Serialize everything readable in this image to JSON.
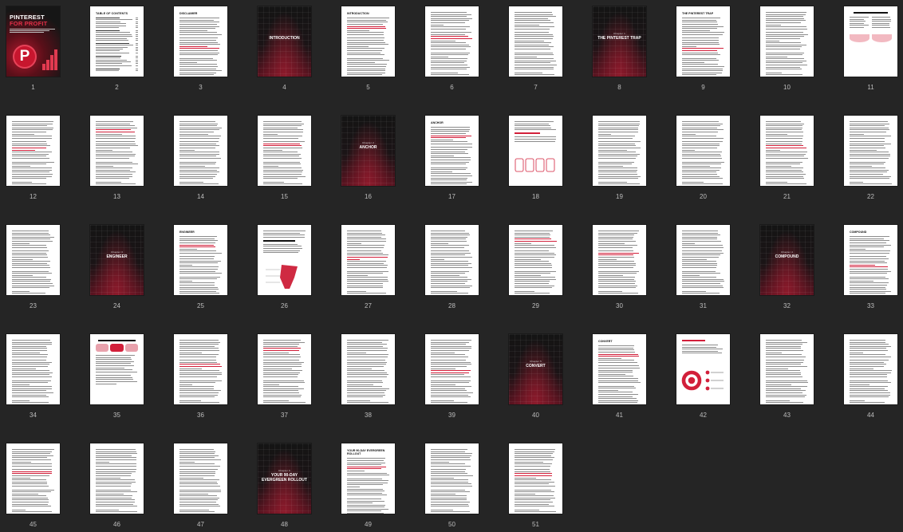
{
  "pages": [
    {
      "n": "1",
      "type": "cover",
      "title1": "PINTEREST",
      "title2": "FOR PROFIT"
    },
    {
      "n": "2",
      "type": "toc",
      "heading": "TABLE OF CONTENTS"
    },
    {
      "n": "3",
      "type": "text",
      "heading": "DISCLAIMER"
    },
    {
      "n": "4",
      "type": "chapter",
      "kicker": "",
      "title": "INTRODUCTION"
    },
    {
      "n": "5",
      "type": "text",
      "heading": "INTRODUCTION"
    },
    {
      "n": "6",
      "type": "text",
      "heading": ""
    },
    {
      "n": "7",
      "type": "text",
      "heading": ""
    },
    {
      "n": "8",
      "type": "chapter",
      "kicker": "Chapter 1",
      "title": "THE PINTEREST TRAP"
    },
    {
      "n": "9",
      "type": "text",
      "heading": "THE PINTEREST TRAP"
    },
    {
      "n": "10",
      "type": "text",
      "heading": ""
    },
    {
      "n": "11",
      "type": "figure",
      "heading": ""
    },
    {
      "n": "12",
      "type": "text",
      "heading": ""
    },
    {
      "n": "13",
      "type": "text",
      "heading": ""
    },
    {
      "n": "14",
      "type": "text",
      "heading": ""
    },
    {
      "n": "15",
      "type": "text",
      "heading": ""
    },
    {
      "n": "16",
      "type": "chapter",
      "kicker": "Chapter 2",
      "title": "ANCHOR"
    },
    {
      "n": "17",
      "type": "text",
      "heading": "ANCHOR"
    },
    {
      "n": "18",
      "type": "figure",
      "heading": ""
    },
    {
      "n": "19",
      "type": "text",
      "heading": ""
    },
    {
      "n": "20",
      "type": "text",
      "heading": ""
    },
    {
      "n": "21",
      "type": "text",
      "heading": ""
    },
    {
      "n": "22",
      "type": "text",
      "heading": ""
    },
    {
      "n": "23",
      "type": "text",
      "heading": ""
    },
    {
      "n": "24",
      "type": "chapter",
      "kicker": "Chapter 3",
      "title": "ENGINEER"
    },
    {
      "n": "25",
      "type": "text",
      "heading": "ENGINEER"
    },
    {
      "n": "26",
      "type": "figure",
      "heading": ""
    },
    {
      "n": "27",
      "type": "text",
      "heading": ""
    },
    {
      "n": "28",
      "type": "text",
      "heading": ""
    },
    {
      "n": "29",
      "type": "text",
      "heading": ""
    },
    {
      "n": "30",
      "type": "text",
      "heading": ""
    },
    {
      "n": "31",
      "type": "text",
      "heading": ""
    },
    {
      "n": "32",
      "type": "chapter",
      "kicker": "Chapter 4",
      "title": "COMPOUND"
    },
    {
      "n": "33",
      "type": "text",
      "heading": "COMPOUND"
    },
    {
      "n": "34",
      "type": "text",
      "heading": ""
    },
    {
      "n": "35",
      "type": "figure",
      "heading": ""
    },
    {
      "n": "36",
      "type": "text",
      "heading": ""
    },
    {
      "n": "37",
      "type": "text",
      "heading": ""
    },
    {
      "n": "38",
      "type": "text",
      "heading": ""
    },
    {
      "n": "39",
      "type": "text",
      "heading": ""
    },
    {
      "n": "40",
      "type": "chapter",
      "kicker": "Chapter 5",
      "title": "CONVERT"
    },
    {
      "n": "41",
      "type": "text",
      "heading": "CONVERT"
    },
    {
      "n": "42",
      "type": "figure",
      "heading": ""
    },
    {
      "n": "43",
      "type": "text",
      "heading": ""
    },
    {
      "n": "44",
      "type": "text",
      "heading": ""
    },
    {
      "n": "45",
      "type": "text",
      "heading": ""
    },
    {
      "n": "46",
      "type": "text",
      "heading": ""
    },
    {
      "n": "47",
      "type": "text",
      "heading": ""
    },
    {
      "n": "48",
      "type": "chapter",
      "kicker": "Chapter 6",
      "title": "YOUR 90-DAY EVERGREEN ROLLOUT"
    },
    {
      "n": "49",
      "type": "text",
      "heading": "YOUR 90-DAY EVERGREEN ROLLOUT"
    },
    {
      "n": "50",
      "type": "text",
      "heading": ""
    },
    {
      "n": "51",
      "type": "text",
      "heading": ""
    }
  ]
}
